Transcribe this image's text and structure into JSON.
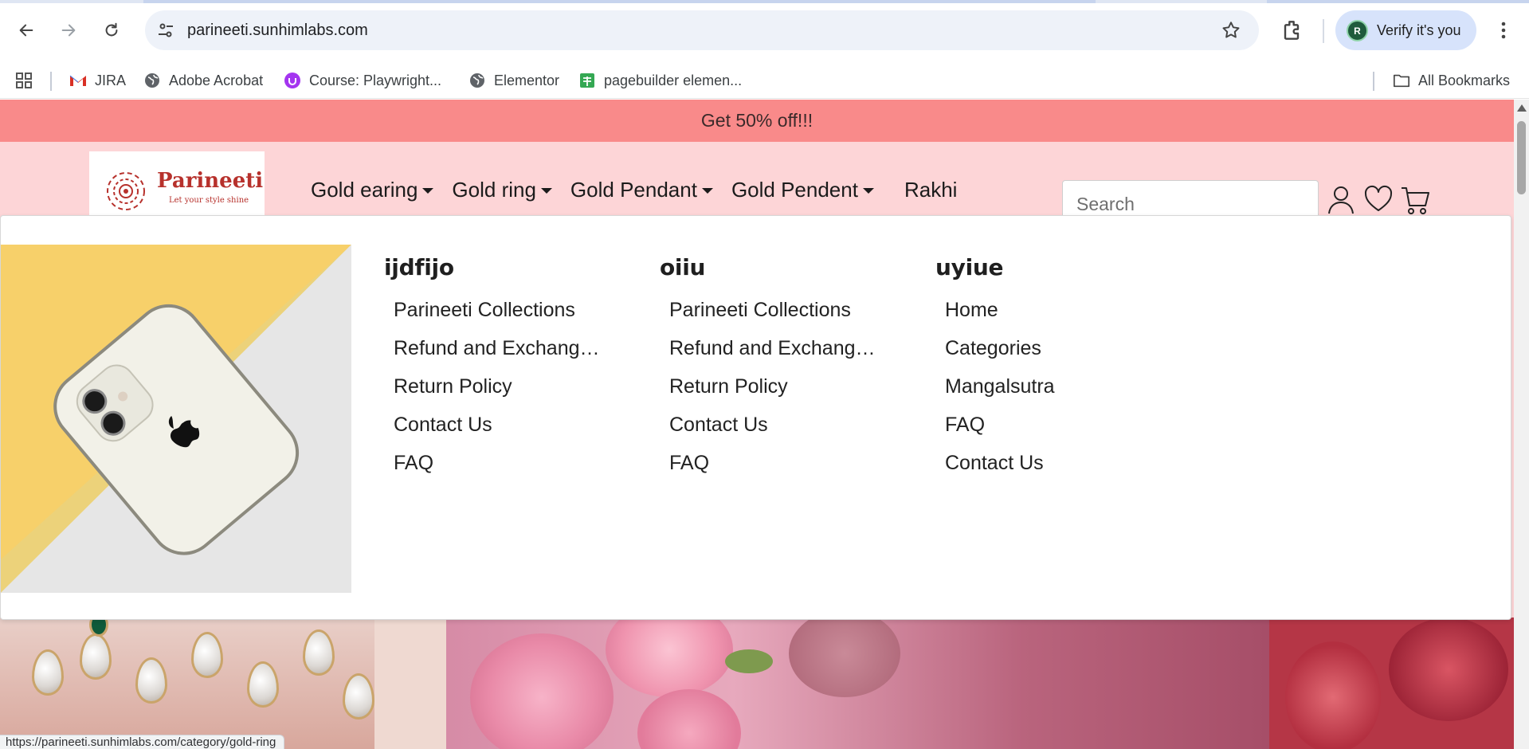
{
  "browser": {
    "url": "parineeti.sunhimlabs.com",
    "profile_initial": "R",
    "profile_label": "Verify it's you",
    "bookmarks": [
      {
        "label": "JIRA",
        "icon": "gmail-icon"
      },
      {
        "label": "Adobe Acrobat",
        "icon": "globe-icon"
      },
      {
        "label": "Course: Playwright...",
        "icon": "udemy-icon"
      },
      {
        "label": "Elementor",
        "icon": "globe-icon"
      },
      {
        "label": "pagebuilder elemen...",
        "icon": "sheets-icon"
      }
    ],
    "all_bookmarks": "All Bookmarks",
    "status_url": "https://parineeti.sunhimlabs.com/category/gold-ring"
  },
  "promo": {
    "text": "Get 50% off!!!"
  },
  "brand": {
    "name": "Parineeti",
    "tagline": "Let your style shine"
  },
  "nav": [
    {
      "label": "Gold earing",
      "has_dropdown": true
    },
    {
      "label": "Gold ring",
      "has_dropdown": true
    },
    {
      "label": "Gold Pendant",
      "has_dropdown": true
    },
    {
      "label": "Gold Pendent",
      "has_dropdown": true
    },
    {
      "label": "Rakhi",
      "has_dropdown": false
    }
  ],
  "search": {
    "placeholder": "Search"
  },
  "mega_menu": {
    "columns": [
      {
        "heading": "ijdfijo",
        "links": [
          "Parineeti Collections",
          "Refund and Exchange Policy",
          "Return Policy",
          "Contact Us",
          "FAQ"
        ]
      },
      {
        "heading": "oiiu",
        "links": [
          "Parineeti Collections",
          "Refund and Exchange Policy",
          "Return Policy",
          "Contact Us",
          "FAQ"
        ]
      },
      {
        "heading": "uyiue",
        "links": [
          "Home",
          "Categories",
          "Mangalsutra",
          "FAQ",
          "Contact Us"
        ]
      }
    ]
  },
  "colors": {
    "promo_bar": "#f98a8a",
    "header_bg": "#fdd5d7",
    "brand_red": "#b7312c"
  }
}
